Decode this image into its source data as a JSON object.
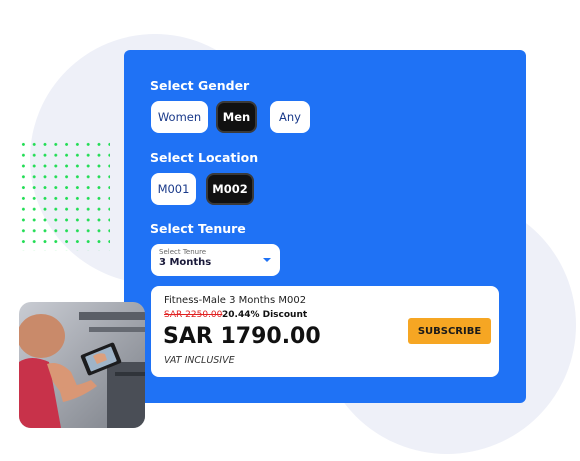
{
  "gender": {
    "title": "Select Gender",
    "options": [
      "Women",
      "Men",
      "Any"
    ],
    "selected": "Men"
  },
  "location": {
    "title": "Select Location",
    "options": [
      "M001",
      "M002"
    ],
    "selected": "M002"
  },
  "tenure": {
    "title": "Select Tenure",
    "select_label": "Select Tenure",
    "select_value": "3 Months"
  },
  "plan": {
    "name": "Fitness-Male 3 Months M002",
    "old_price": "SAR 2250.00",
    "discount": "20.44% Discount",
    "price": "SAR 1790.00",
    "vat": "VAT INCLUSIVE",
    "subscribe_label": "SUBSCRIBE"
  },
  "colors": {
    "panel": "#1f72f5",
    "subscribe": "#f6a623",
    "dots": "#22dd55"
  },
  "decor": {
    "photo": "person-using-tablet-photo"
  }
}
